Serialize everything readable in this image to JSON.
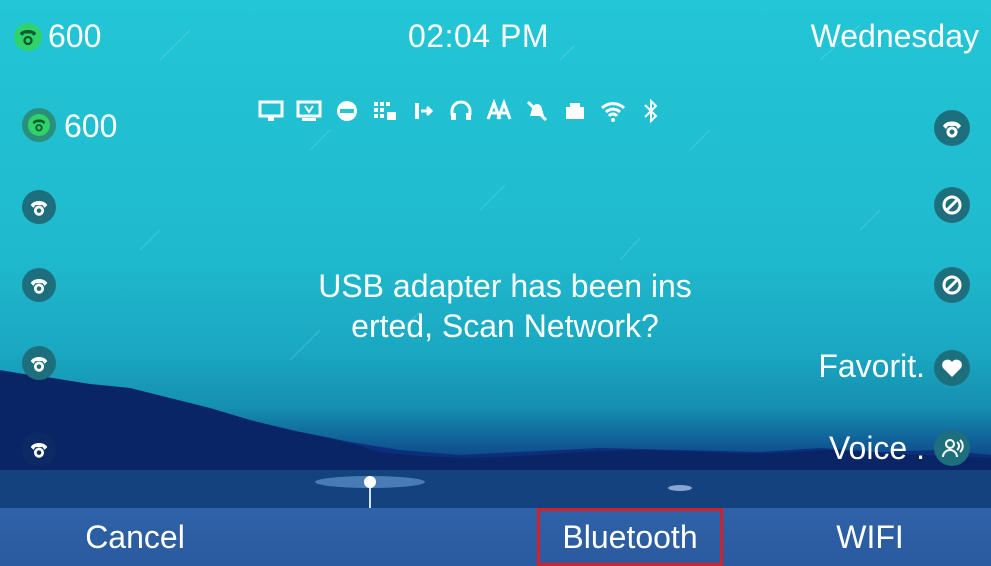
{
  "status": {
    "line_number": "600",
    "time": "02:04 PM",
    "day": "Wednesday"
  },
  "line_keys": [
    {
      "label": "600",
      "icon": "phone-icon",
      "active": true
    },
    {
      "label": "",
      "icon": "phone-icon",
      "active": false
    },
    {
      "label": "",
      "icon": "phone-icon",
      "active": false
    },
    {
      "label": "",
      "icon": "phone-icon",
      "active": false
    },
    {
      "label": "",
      "icon": "phone-icon",
      "active": false
    }
  ],
  "status_icons": [
    "monitor-icon",
    "tv-icon",
    "dnd-icon",
    "keypad-lock-icon",
    "forward-icon",
    "headset-icon",
    "auto-answer-icon",
    "mute-icon",
    "usb-icon",
    "wifi-icon",
    "bluetooth-icon"
  ],
  "right_keys": [
    {
      "label": "",
      "icon": "phone-icon"
    },
    {
      "label": "",
      "icon": "blocked-icon"
    },
    {
      "label": "",
      "icon": "blocked-icon"
    },
    {
      "label": "Favorit.",
      "icon": "heart-icon"
    },
    {
      "label": "Voice .",
      "icon": "voice-icon"
    }
  ],
  "dialog": {
    "line1": "USB adapter has been ins",
    "line2": "erted, Scan Network?"
  },
  "softkeys": {
    "cancel": "Cancel",
    "bluetooth": "Bluetooth",
    "wifi": "WIFI"
  },
  "colors": {
    "sky": "#22c6d6",
    "softkey_bar": "#2f62a8",
    "highlight": "#d4202a",
    "active_line": "#2fd36a"
  }
}
